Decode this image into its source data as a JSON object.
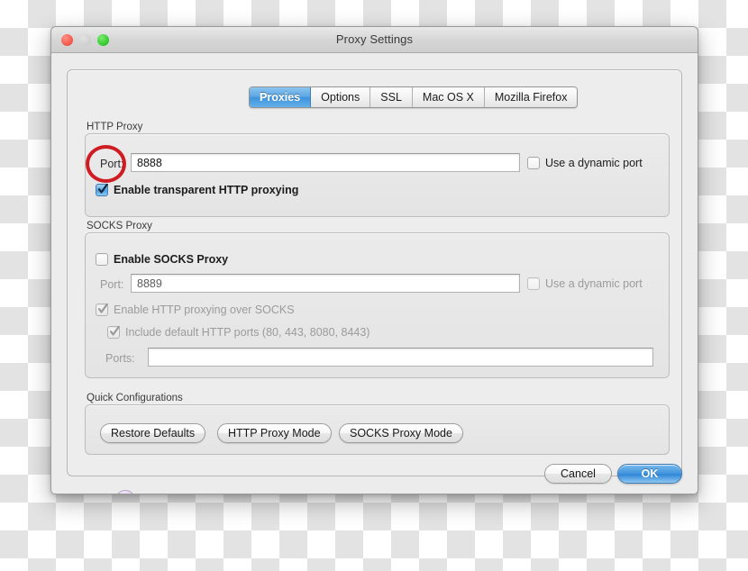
{
  "window": {
    "title": "Proxy Settings",
    "traffic_lights": [
      "close-button",
      "minimize-button",
      "zoom-button"
    ]
  },
  "tabs": [
    {
      "label": "Proxies",
      "selected": true
    },
    {
      "label": "Options",
      "selected": false
    },
    {
      "label": "SSL",
      "selected": false
    },
    {
      "label": "Mac OS X",
      "selected": false
    },
    {
      "label": "Mozilla Firefox",
      "selected": false
    }
  ],
  "http_proxy": {
    "group_label": "HTTP Proxy",
    "port_label": "Port:",
    "port_value": "8888",
    "port_placeholder": "",
    "dynamic_port_label": "Use a dynamic port",
    "dynamic_port_checked": false,
    "transparent_label": "Enable transparent HTTP proxying",
    "transparent_checked": true
  },
  "socks_proxy": {
    "group_label": "SOCKS Proxy",
    "enable_label": "Enable SOCKS Proxy",
    "enable_checked": false,
    "port_label": "Port:",
    "port_value": "8889",
    "dynamic_port_label": "Use a dynamic port",
    "dynamic_port_checked": false,
    "http_over_socks_label": "Enable HTTP proxying over SOCKS",
    "http_over_socks_checked": true,
    "default_ports_label": "Include default HTTP ports (80, 443, 8080, 8443)",
    "default_ports_checked": true,
    "ports_label": "Ports:",
    "ports_value": "",
    "ports_placeholder": ""
  },
  "quick_config": {
    "group_label": "Quick Configurations",
    "buttons": [
      {
        "label": "Restore Defaults"
      },
      {
        "label": "HTTP Proxy Mode"
      },
      {
        "label": "SOCKS Proxy Mode"
      }
    ]
  },
  "footer": {
    "help_label": "?",
    "cancel_label": "Cancel",
    "ok_label": "OK"
  },
  "annotation": {
    "name": "red-highlight-ellipse",
    "color": "#cf1b22",
    "target": "Enable transparent HTTP proxying checkbox"
  },
  "colors": {
    "accent_blue": "#3f93dd",
    "annotation_red": "#cf1b22",
    "window_chrome": "#ececec",
    "traffic_close": "#f2564a",
    "traffic_minimize": "#cfcfcf",
    "traffic_zoom": "#2fc82b"
  }
}
